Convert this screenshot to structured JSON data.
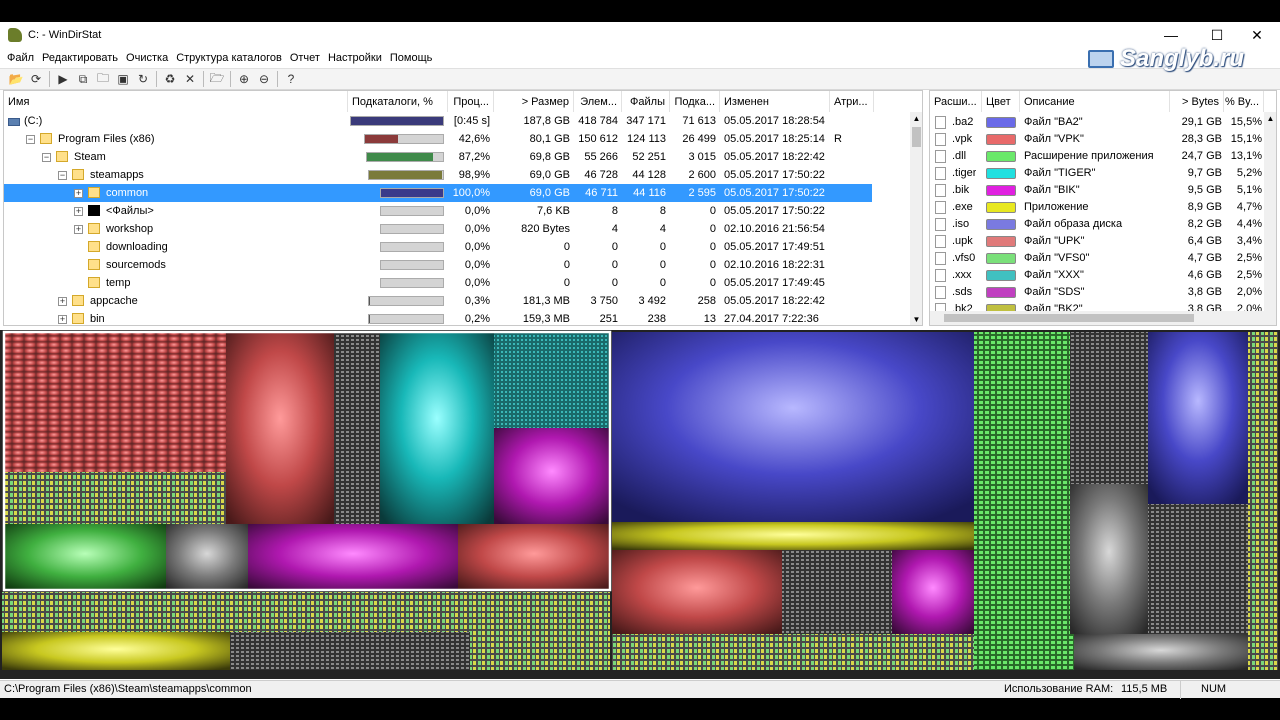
{
  "window": {
    "title": "C: - WinDirStat",
    "minimize": "—",
    "maximize": "☐",
    "close": "✕"
  },
  "watermark": "Sanglyb.ru",
  "menu": [
    "Файл",
    "Редактировать",
    "Очистка",
    "Структура каталогов",
    "Отчет",
    "Настройки",
    "Помощь"
  ],
  "toolbar": [
    {
      "icon": "open-icon",
      "g": "📂"
    },
    {
      "icon": "refresh-icon",
      "g": "⟳"
    },
    {
      "sep": true
    },
    {
      "icon": "play-icon",
      "g": "▶"
    },
    {
      "icon": "copy-path-icon",
      "g": "⧉"
    },
    {
      "icon": "explorer-icon",
      "g": "🗀"
    },
    {
      "icon": "cmd-icon",
      "g": "▣"
    },
    {
      "icon": "refresh-selected-icon",
      "g": "↻"
    },
    {
      "sep": true
    },
    {
      "icon": "recycle-icon",
      "g": "♻"
    },
    {
      "icon": "delete-icon",
      "g": "✕"
    },
    {
      "sep": true
    },
    {
      "icon": "new-folder-icon",
      "g": "🗁"
    },
    {
      "sep": true
    },
    {
      "icon": "zoom-in-icon",
      "g": "⊕"
    },
    {
      "icon": "zoom-out-icon",
      "g": "⊖"
    },
    {
      "sep": true
    },
    {
      "icon": "help-icon",
      "g": "?"
    }
  ],
  "tree": {
    "columns": [
      "Имя",
      "Подкаталоги, %",
      "Проц...",
      "> Размер",
      "Элем...",
      "Файлы",
      "Подка...",
      "Изменен",
      "Атри..."
    ],
    "rows": [
      {
        "name": "(C:)",
        "pct_sub": "",
        "pct": "[0:45 s]",
        "size": "187,8 GB",
        "items": "418 784",
        "files": "347 171",
        "subdirs": "71 613",
        "modified": "05.05.2017  18:28:54",
        "attr": "",
        "depth": 0,
        "exp": "",
        "icon": "drive",
        "fill": 1.0,
        "color": "#3a3a7a"
      },
      {
        "name": "Program Files (x86)",
        "pct": "42,6%",
        "size": "80,1 GB",
        "items": "150 612",
        "files": "124 113",
        "subdirs": "26 499",
        "modified": "05.05.2017  18:25:14",
        "attr": "R",
        "depth": 1,
        "exp": "−",
        "icon": "folder",
        "fill": 0.426,
        "color": "#8b3a3a"
      },
      {
        "name": "Steam",
        "pct": "87,2%",
        "size": "69,8 GB",
        "items": "55 266",
        "files": "52 251",
        "subdirs": "3 015",
        "modified": "05.05.2017  18:22:42",
        "attr": "",
        "depth": 2,
        "exp": "−",
        "icon": "folder",
        "fill": 0.872,
        "color": "#3f8a4a"
      },
      {
        "name": "steamapps",
        "pct": "98,9%",
        "size": "69,0 GB",
        "items": "46 728",
        "files": "44 128",
        "subdirs": "2 600",
        "modified": "05.05.2017  17:50:22",
        "attr": "",
        "depth": 3,
        "exp": "−",
        "icon": "folder",
        "fill": 0.989,
        "color": "#7a7a3a"
      },
      {
        "name": "common",
        "pct": "100,0%",
        "size": "69,0 GB",
        "items": "46 711",
        "files": "44 116",
        "subdirs": "2 595",
        "modified": "05.05.2017  17:50:22",
        "attr": "",
        "depth": 4,
        "exp": "+",
        "icon": "folder",
        "fill": 1.0,
        "color": "#3a3a8a",
        "sel": true
      },
      {
        "name": "<Файлы>",
        "pct": "0,0%",
        "size": "7,6 KB",
        "items": "8",
        "files": "8",
        "subdirs": "0",
        "modified": "05.05.2017  17:50:22",
        "attr": "",
        "depth": 4,
        "exp": "+",
        "icon": "black",
        "fill": 0.0,
        "color": "#555"
      },
      {
        "name": "workshop",
        "pct": "0,0%",
        "size": "820 Bytes",
        "items": "4",
        "files": "4",
        "subdirs": "0",
        "modified": "02.10.2016  21:56:54",
        "attr": "",
        "depth": 4,
        "exp": "+",
        "icon": "folder",
        "fill": 0.0,
        "color": "#555"
      },
      {
        "name": "downloading",
        "pct": "0,0%",
        "size": "0",
        "items": "0",
        "files": "0",
        "subdirs": "0",
        "modified": "05.05.2017  17:49:51",
        "attr": "",
        "depth": 4,
        "exp": "",
        "icon": "folder",
        "fill": 0.0,
        "color": "#555"
      },
      {
        "name": "sourcemods",
        "pct": "0,0%",
        "size": "0",
        "items": "0",
        "files": "0",
        "subdirs": "0",
        "modified": "02.10.2016  18:22:31",
        "attr": "",
        "depth": 4,
        "exp": "",
        "icon": "folder",
        "fill": 0.0,
        "color": "#555"
      },
      {
        "name": "temp",
        "pct": "0,0%",
        "size": "0",
        "items": "0",
        "files": "0",
        "subdirs": "0",
        "modified": "05.05.2017  17:49:45",
        "attr": "",
        "depth": 4,
        "exp": "",
        "icon": "folder",
        "fill": 0.0,
        "color": "#555"
      },
      {
        "name": "appcache",
        "pct": "0,3%",
        "size": "181,3 MB",
        "items": "3 750",
        "files": "3 492",
        "subdirs": "258",
        "modified": "05.05.2017  18:22:42",
        "attr": "",
        "depth": 3,
        "exp": "+",
        "icon": "folder",
        "fill": 0.003,
        "color": "#555"
      },
      {
        "name": "bin",
        "pct": "0,2%",
        "size": "159,3 MB",
        "items": "251",
        "files": "238",
        "subdirs": "13",
        "modified": "27.04.2017  7:22:36",
        "attr": "",
        "depth": 3,
        "exp": "+",
        "icon": "folder",
        "fill": 0.002,
        "color": "#555"
      }
    ]
  },
  "extensions": {
    "columns": [
      "Расши...",
      "Цвет",
      "Описание",
      "> Bytes",
      "% By..."
    ],
    "rows": [
      {
        "ext": ".ba2",
        "color": "#6a6ae8",
        "desc": "Файл \"BA2\"",
        "bytes": "29,1 GB",
        "pct": "15,5%"
      },
      {
        "ext": ".vpk",
        "color": "#e86a6a",
        "desc": "Файл \"VPK\"",
        "bytes": "28,3 GB",
        "pct": "15,1%"
      },
      {
        "ext": ".dll",
        "color": "#6ae86a",
        "desc": "Расширение приложения",
        "bytes": "24,7 GB",
        "pct": "13,1%"
      },
      {
        "ext": ".tiger",
        "color": "#20e0e0",
        "desc": "Файл \"TIGER\"",
        "bytes": "9,7 GB",
        "pct": "5,2%"
      },
      {
        "ext": ".bik",
        "color": "#e020e0",
        "desc": "Файл \"BIK\"",
        "bytes": "9,5 GB",
        "pct": "5,1%"
      },
      {
        "ext": ".exe",
        "color": "#e8e820",
        "desc": "Приложение",
        "bytes": "8,9 GB",
        "pct": "4,7%"
      },
      {
        "ext": ".iso",
        "color": "#7a7ae0",
        "desc": "Файл образа диска",
        "bytes": "8,2 GB",
        "pct": "4,4%"
      },
      {
        "ext": ".upk",
        "color": "#e07a7a",
        "desc": "Файл \"UPK\"",
        "bytes": "6,4 GB",
        "pct": "3,4%"
      },
      {
        "ext": ".vfs0",
        "color": "#7ae07a",
        "desc": "Файл \"VFS0\"",
        "bytes": "4,7 GB",
        "pct": "2,5%"
      },
      {
        "ext": ".xxx",
        "color": "#40c0c0",
        "desc": "Файл \"XXX\"",
        "bytes": "4,6 GB",
        "pct": "2,5%"
      },
      {
        "ext": ".sds",
        "color": "#c040c0",
        "desc": "Файл \"SDS\"",
        "bytes": "3,8 GB",
        "pct": "2,0%"
      },
      {
        "ext": ".bk2",
        "color": "#c0c040",
        "desc": "Файл \"BK2\"",
        "bytes": "3,8 GB",
        "pct": "2,0%"
      }
    ]
  },
  "status": {
    "path": "C:\\Program Files (x86)\\Steam\\steamapps\\common",
    "ram_label": "Использование RAM:",
    "ram_value": "115,5 MB",
    "num": "NUM"
  }
}
